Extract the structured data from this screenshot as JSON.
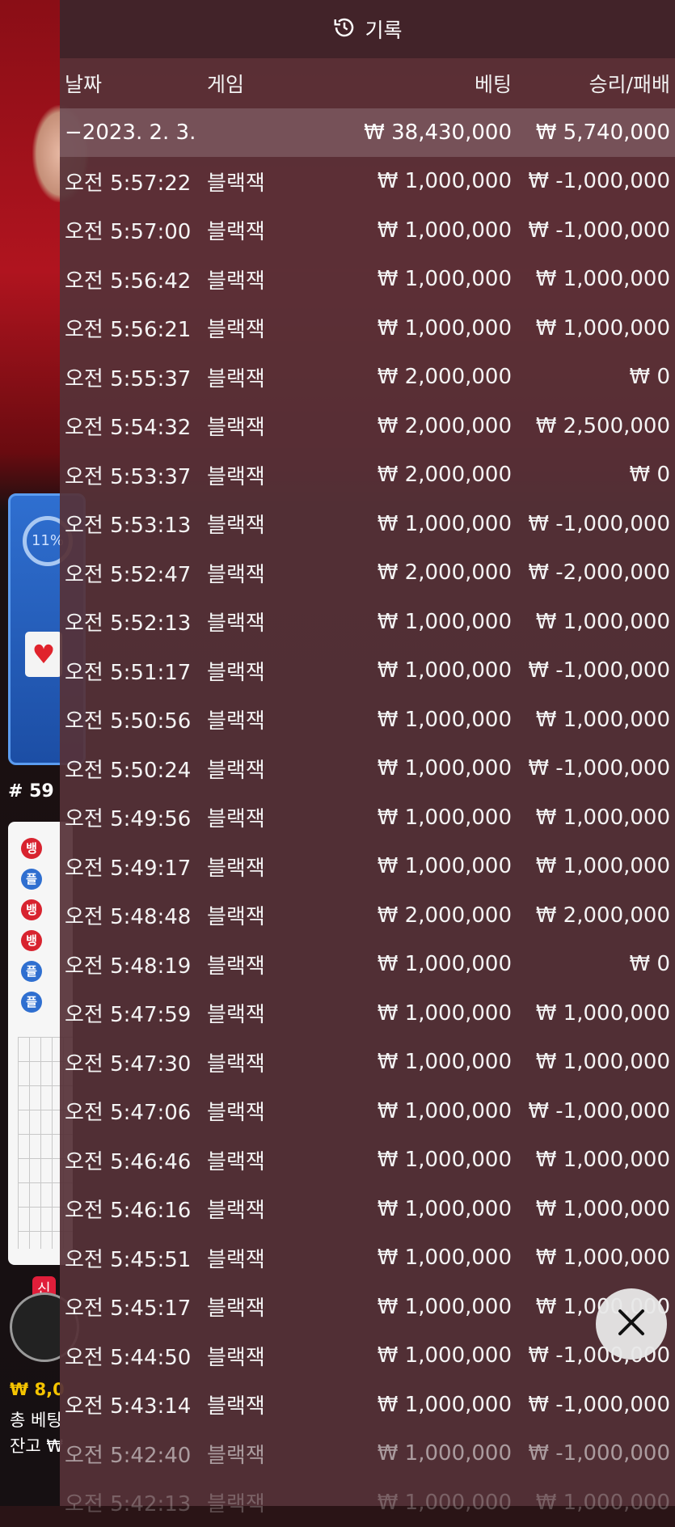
{
  "background": {
    "percent_label": "11%",
    "round_number": "# 59",
    "road_labels": [
      "뱅",
      "플",
      "뱅",
      "뱅",
      "플",
      "플"
    ],
    "new_badge": "신",
    "balance_amount": "₩ 8,0",
    "total_bet_label": "총 베팅",
    "remain_label": "잔고 ₩"
  },
  "history": {
    "title": "기록",
    "columns": {
      "date": "날짜",
      "game": "게임",
      "bet": "베팅",
      "win_loss": "승리/패배"
    },
    "summary": {
      "date": "−2023. 2. 3.",
      "bet": "₩ 38,430,000",
      "win_loss": "₩ 5,740,000"
    },
    "rows": [
      {
        "time": "오전 5:57:22",
        "game": "블랙잭",
        "bet": "₩ 1,000,000",
        "result": "₩ -1,000,000"
      },
      {
        "time": "오전 5:57:00",
        "game": "블랙잭",
        "bet": "₩ 1,000,000",
        "result": "₩ -1,000,000"
      },
      {
        "time": "오전 5:56:42",
        "game": "블랙잭",
        "bet": "₩ 1,000,000",
        "result": "₩ 1,000,000"
      },
      {
        "time": "오전 5:56:21",
        "game": "블랙잭",
        "bet": "₩ 1,000,000",
        "result": "₩ 1,000,000"
      },
      {
        "time": "오전 5:55:37",
        "game": "블랙잭",
        "bet": "₩ 2,000,000",
        "result": "₩ 0"
      },
      {
        "time": "오전 5:54:32",
        "game": "블랙잭",
        "bet": "₩ 2,000,000",
        "result": "₩ 2,500,000"
      },
      {
        "time": "오전 5:53:37",
        "game": "블랙잭",
        "bet": "₩ 2,000,000",
        "result": "₩ 0"
      },
      {
        "time": "오전 5:53:13",
        "game": "블랙잭",
        "bet": "₩ 1,000,000",
        "result": "₩ -1,000,000"
      },
      {
        "time": "오전 5:52:47",
        "game": "블랙잭",
        "bet": "₩ 2,000,000",
        "result": "₩ -2,000,000"
      },
      {
        "time": "오전 5:52:13",
        "game": "블랙잭",
        "bet": "₩ 1,000,000",
        "result": "₩ 1,000,000"
      },
      {
        "time": "오전 5:51:17",
        "game": "블랙잭",
        "bet": "₩ 1,000,000",
        "result": "₩ -1,000,000"
      },
      {
        "time": "오전 5:50:56",
        "game": "블랙잭",
        "bet": "₩ 1,000,000",
        "result": "₩ 1,000,000"
      },
      {
        "time": "오전 5:50:24",
        "game": "블랙잭",
        "bet": "₩ 1,000,000",
        "result": "₩ -1,000,000"
      },
      {
        "time": "오전 5:49:56",
        "game": "블랙잭",
        "bet": "₩ 1,000,000",
        "result": "₩ 1,000,000"
      },
      {
        "time": "오전 5:49:17",
        "game": "블랙잭",
        "bet": "₩ 1,000,000",
        "result": "₩ 1,000,000"
      },
      {
        "time": "오전 5:48:48",
        "game": "블랙잭",
        "bet": "₩ 2,000,000",
        "result": "₩ 2,000,000"
      },
      {
        "time": "오전 5:48:19",
        "game": "블랙잭",
        "bet": "₩ 1,000,000",
        "result": "₩ 0"
      },
      {
        "time": "오전 5:47:59",
        "game": "블랙잭",
        "bet": "₩ 1,000,000",
        "result": "₩ 1,000,000"
      },
      {
        "time": "오전 5:47:30",
        "game": "블랙잭",
        "bet": "₩ 1,000,000",
        "result": "₩ 1,000,000"
      },
      {
        "time": "오전 5:47:06",
        "game": "블랙잭",
        "bet": "₩ 1,000,000",
        "result": "₩ -1,000,000"
      },
      {
        "time": "오전 5:46:46",
        "game": "블랙잭",
        "bet": "₩ 1,000,000",
        "result": "₩ 1,000,000"
      },
      {
        "time": "오전 5:46:16",
        "game": "블랙잭",
        "bet": "₩ 1,000,000",
        "result": "₩ 1,000,000"
      },
      {
        "time": "오전 5:45:51",
        "game": "블랙잭",
        "bet": "₩ 1,000,000",
        "result": "₩ 1,000,000"
      },
      {
        "time": "오전 5:45:17",
        "game": "블랙잭",
        "bet": "₩ 1,000,000",
        "result": "₩ 1,000,000"
      },
      {
        "time": "오전 5:44:50",
        "game": "블랙잭",
        "bet": "₩ 1,000,000",
        "result": "₩ -1,000,000"
      },
      {
        "time": "오전 5:43:14",
        "game": "블랙잭",
        "bet": "₩ 1,000,000",
        "result": "₩ -1,000,000"
      },
      {
        "time": "오전 5:42:40",
        "game": "블랙잭",
        "bet": "₩ 1,000,000",
        "result": "₩ -1,000,000"
      },
      {
        "time": "오전 5:42:13",
        "game": "블랙잭",
        "bet": "₩ 1,000,000",
        "result": "₩ 1,000,000"
      }
    ]
  },
  "colors": {
    "panel_bg": "#563238",
    "summary_bg": "#8c6e74",
    "banker_red": "#d8232f",
    "player_blue": "#2f6fd0",
    "accent_yellow": "#f5c400"
  }
}
